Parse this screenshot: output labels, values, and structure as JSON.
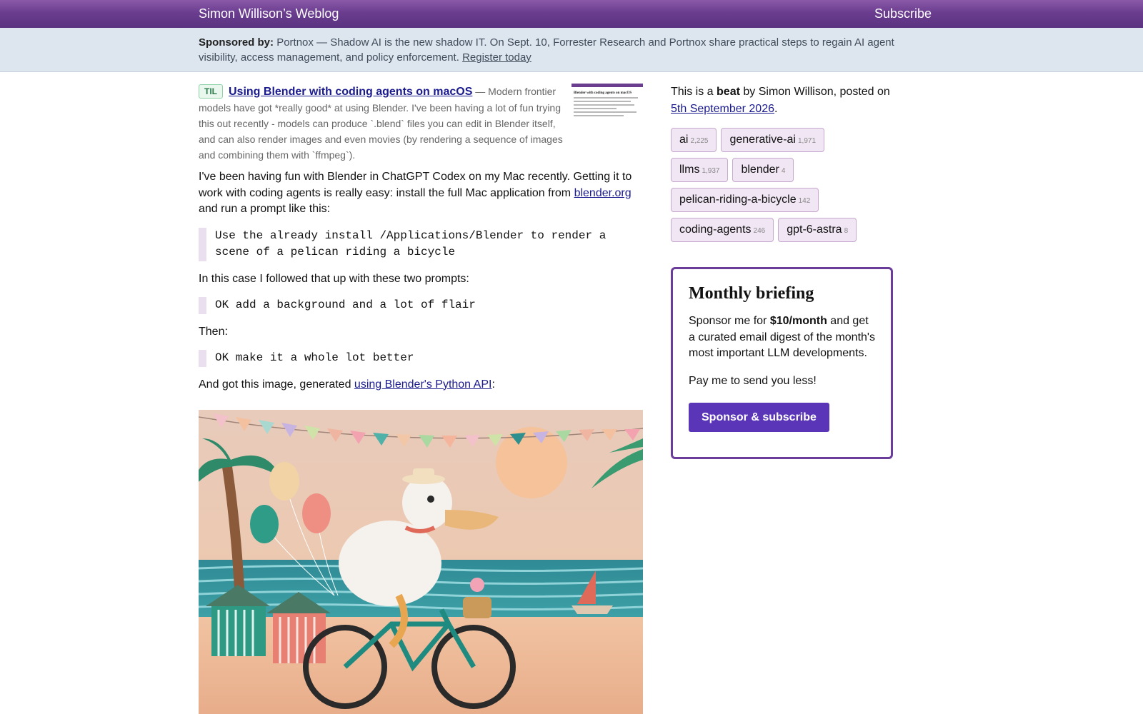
{
  "header": {
    "site_title": "Simon Willison’s Weblog",
    "subscribe_label": "Subscribe"
  },
  "sponsor": {
    "label": "Sponsored by:",
    "text": "Portnox — Shadow AI is the new shadow IT. On Sept. 10, Forrester Research and Portnox share practical steps to regain AI agent visibility, access management, and policy enforcement.",
    "link_label": "Register today"
  },
  "til": {
    "badge": "TIL",
    "title": "Using Blender with coding agents on macOS",
    "summary": "— Modern frontier models have got *really good* at using Blender. I've been having a lot of fun trying this out recently - models can produce `.blend` files you can edit in Blender itself, and can also render images and even movies (by rendering a sequence of images and combining them with `ffmpeg`).",
    "thumb_title": "Blender with coding agents on macOS"
  },
  "article": {
    "p1_before": "I've been having fun with Blender in ChatGPT Codex on my Mac recently. Getting it to work with coding agents is really easy: install the full Mac application from ",
    "p1_link": "blender.org",
    "p1_after": " and run a prompt like this:",
    "quote1": "Use the already install /Applications/Blender to render a scene of a pelican riding a bicycle",
    "p2": "In this case I followed that up with these two prompts:",
    "quote2": "OK add a background and a lot of flair",
    "p3": "Then:",
    "quote3": "OK make it a whole lot better",
    "p4_before": "And got this image, generated ",
    "p4_link": "using Blender's Python API",
    "p4_after": ":"
  },
  "sidebar": {
    "beat_1": "This is a ",
    "beat_bold": "beat",
    "beat_2": " by Simon Willison, posted on",
    "date": "5th September 2026",
    "beat_end": ".",
    "tags": [
      {
        "name": "ai",
        "count": "2,225"
      },
      {
        "name": "generative-ai",
        "count": "1,971"
      },
      {
        "name": "llms",
        "count": "1,937"
      },
      {
        "name": "blender",
        "count": "4"
      },
      {
        "name": "pelican-riding-a-bicycle",
        "count": "142"
      },
      {
        "name": "coding-agents",
        "count": "246"
      },
      {
        "name": "gpt-6-astra",
        "count": "8"
      }
    ]
  },
  "briefing": {
    "title": "Monthly briefing",
    "p1_before": "Sponsor me for ",
    "p1_bold": "$10/month",
    "p1_after": " and get a curated email digest of the month's most important LLM developments.",
    "p2": "Pay me to send you less!",
    "button": "Sponsor & subscribe"
  },
  "colors": {
    "header": "#6b3d8f",
    "sponsor_bg": "#dde6ef",
    "link": "#1a1a8f",
    "tag_bg": "#f1e6f4",
    "button": "#5a35b8"
  }
}
